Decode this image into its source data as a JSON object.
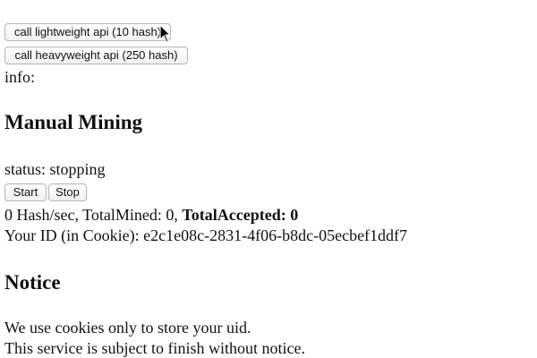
{
  "buttons": {
    "light_api": "call lightweight api (10 hash)",
    "heavy_api": "call heavyweight api (250 hash)",
    "start": "Start",
    "stop": "Stop"
  },
  "info_label": "info:",
  "mining": {
    "heading": "Manual Mining",
    "status_label": "status:",
    "status_value": "stopping",
    "hash_rate": "0 Hash/sec, ",
    "total_mined": "TotalMined: 0, ",
    "total_accepted": "TotalAccepted: 0",
    "id_label": "Your ID (in Cookie): ",
    "id_value": "e2c1e08c-2831-4f06-b8dc-05ecbef1ddf7"
  },
  "notice": {
    "heading": "Notice",
    "line1": "We use cookies only to store your uid.",
    "line2": "This service is subject to finish without notice."
  },
  "icons": {
    "cursor": "mouse-pointer-icon"
  }
}
